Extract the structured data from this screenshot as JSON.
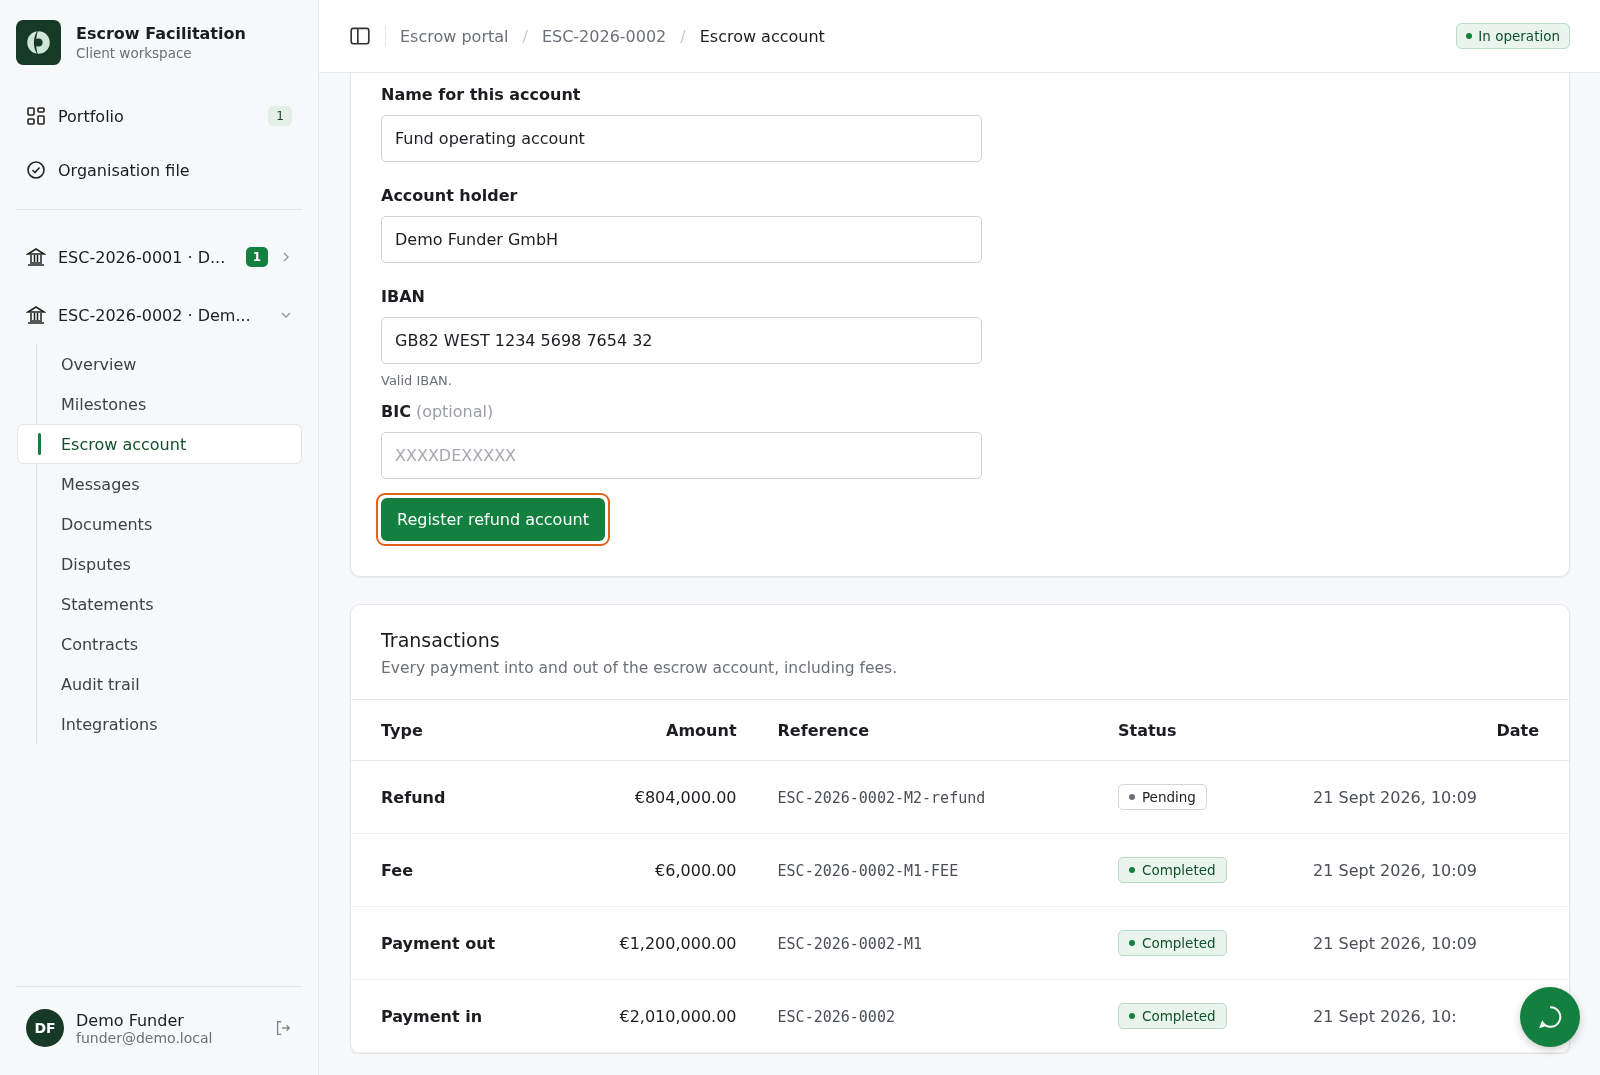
{
  "brand": {
    "title": "Escrow Facilitation",
    "subtitle": "Client workspace"
  },
  "nav": [
    {
      "kind": "portfolio",
      "label": "Portfolio",
      "badge": "1"
    },
    {
      "kind": "file",
      "label": "Organisation file"
    }
  ],
  "escrows": [
    {
      "label": "ESC-2026-0001 · D...",
      "badge": "1",
      "expanded": false,
      "children": []
    },
    {
      "label": "ESC-2026-0002 · Dem...",
      "expanded": true,
      "children": [
        {
          "label": "Overview",
          "selected": false
        },
        {
          "label": "Milestones",
          "selected": false
        },
        {
          "label": "Escrow account",
          "selected": true
        },
        {
          "label": "Messages",
          "selected": false
        },
        {
          "label": "Documents",
          "selected": false
        },
        {
          "label": "Disputes",
          "selected": false
        },
        {
          "label": "Statements",
          "selected": false
        },
        {
          "label": "Contracts",
          "selected": false
        },
        {
          "label": "Audit trail",
          "selected": false
        },
        {
          "label": "Integrations",
          "selected": false
        }
      ]
    }
  ],
  "user": {
    "initials": "DF",
    "name": "Demo Funder",
    "email": "funder@demo.local"
  },
  "breadcrumbs": [
    "Escrow portal",
    "ESC-2026-0002",
    "Escrow account"
  ],
  "breadcrumb_separator": "/",
  "status_badge": "In operation",
  "form": {
    "fields": [
      {
        "label": "Name for this account",
        "value": "Fund operating account"
      },
      {
        "label": "Account holder",
        "value": "Demo Funder GmbH"
      },
      {
        "label": "IBAN",
        "value": "GB82 WEST 1234 5698 7654 32",
        "hint": "Valid IBAN."
      },
      {
        "label": "BIC",
        "optional": "(optional)",
        "placeholder": "XXXXDEXXXXX"
      }
    ],
    "submit": "Register refund account"
  },
  "transactions": {
    "title": "Transactions",
    "subtitle": "Every payment into and out of the escrow account, including fees.",
    "columns": [
      "Type",
      "Amount",
      "Reference",
      "Status",
      "Date"
    ],
    "rows": [
      {
        "type": "Refund",
        "amount": "€804,000.00",
        "reference": "ESC-2026-0002-M2-refund",
        "status": "Pending",
        "kind": "pending",
        "date": "21 Sept 2026, 10:09"
      },
      {
        "type": "Fee",
        "amount": "€6,000.00",
        "reference": "ESC-2026-0002-M1-FEE",
        "status": "Completed",
        "kind": "completed",
        "date": "21 Sept 2026, 10:09"
      },
      {
        "type": "Payment out",
        "amount": "€1,200,000.00",
        "reference": "ESC-2026-0002-M1",
        "status": "Completed",
        "kind": "completed",
        "date": "21 Sept 2026, 10:09"
      },
      {
        "type": "Payment in",
        "amount": "€2,010,000.00",
        "reference": "ESC-2026-0002",
        "status": "Completed",
        "kind": "completed",
        "date": "21 Sept 2026, 10:"
      }
    ]
  }
}
